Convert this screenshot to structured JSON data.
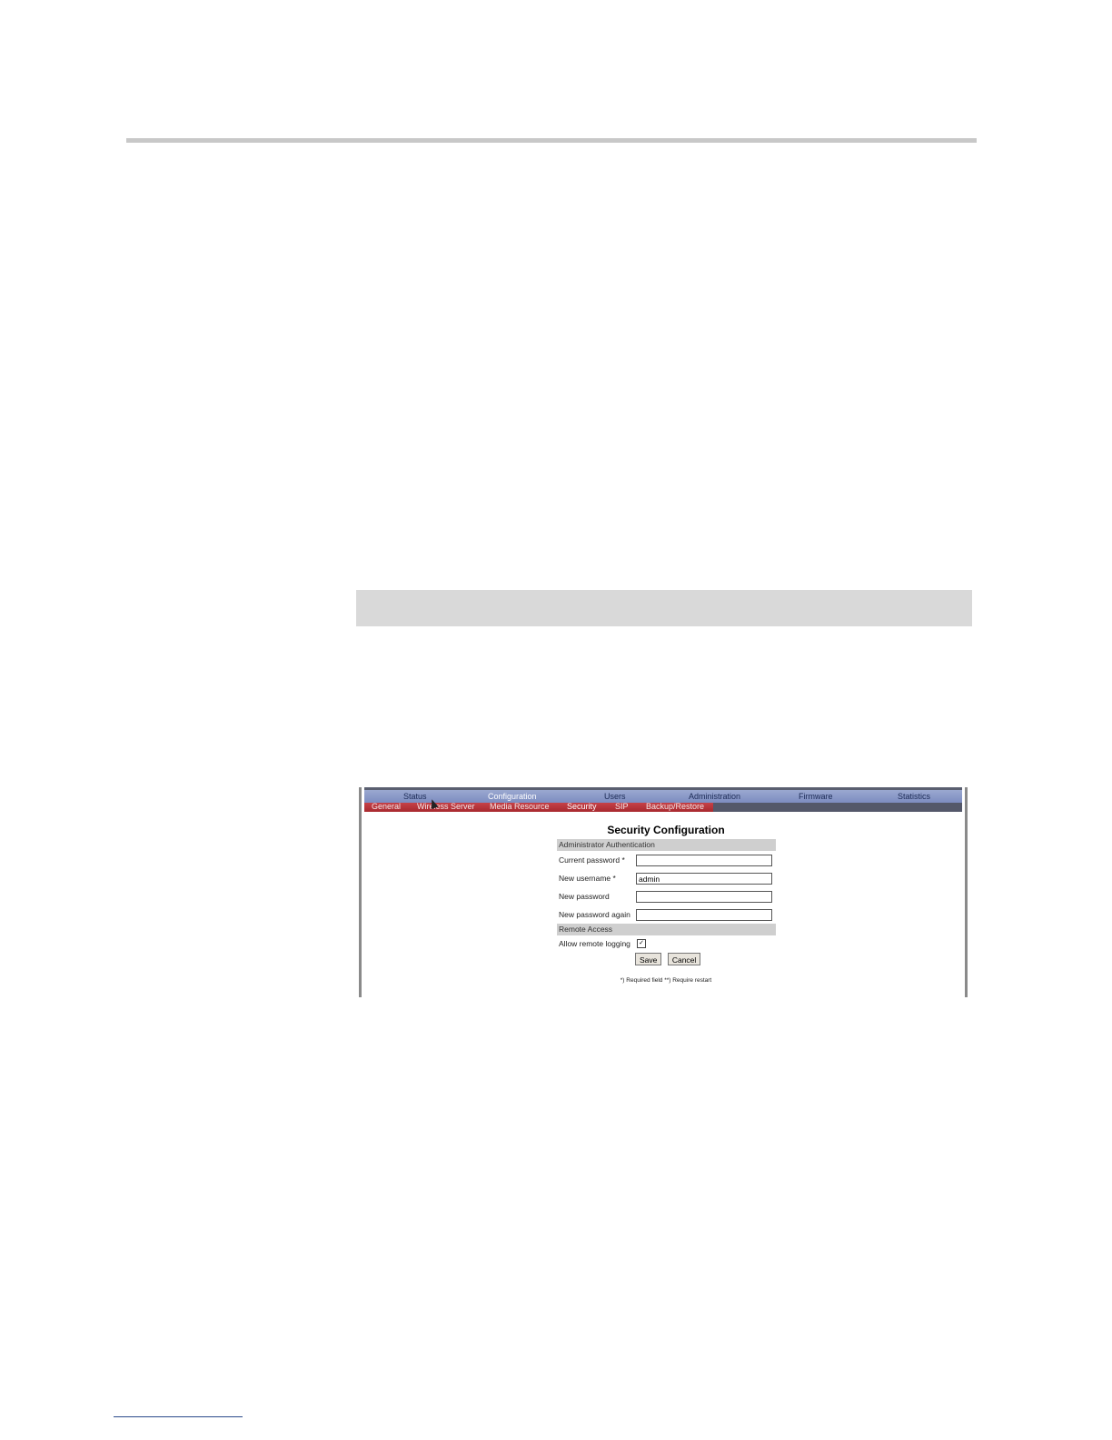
{
  "screenshot": {
    "top_nav": [
      "Status",
      "Configuration",
      "Users",
      "Administration",
      "Firmware",
      "Statistics"
    ],
    "top_nav_active": "Configuration",
    "sub_nav": [
      "General",
      "Wireless Server",
      "Media Resource",
      "Security",
      "SIP",
      "Backup/Restore"
    ],
    "sub_nav_active": "Security",
    "title": "Security Configuration",
    "section_admin": "Administrator Authentication",
    "fields": [
      {
        "label": "Current password *",
        "value": ""
      },
      {
        "label": "New username *",
        "value": "admin"
      },
      {
        "label": "New password",
        "value": ""
      },
      {
        "label": "New password again",
        "value": ""
      }
    ],
    "section_remote": "Remote Access",
    "remote_logging_label": "Allow remote logging",
    "remote_logging_checked": true,
    "save_label": "Save",
    "cancel_label": "Cancel",
    "note": "*) Required field **) Require restart"
  },
  "colors": {
    "top_nav": "#8a98c8",
    "sub_nav": "#b8333a",
    "section_bar": "#cfcfcf"
  }
}
